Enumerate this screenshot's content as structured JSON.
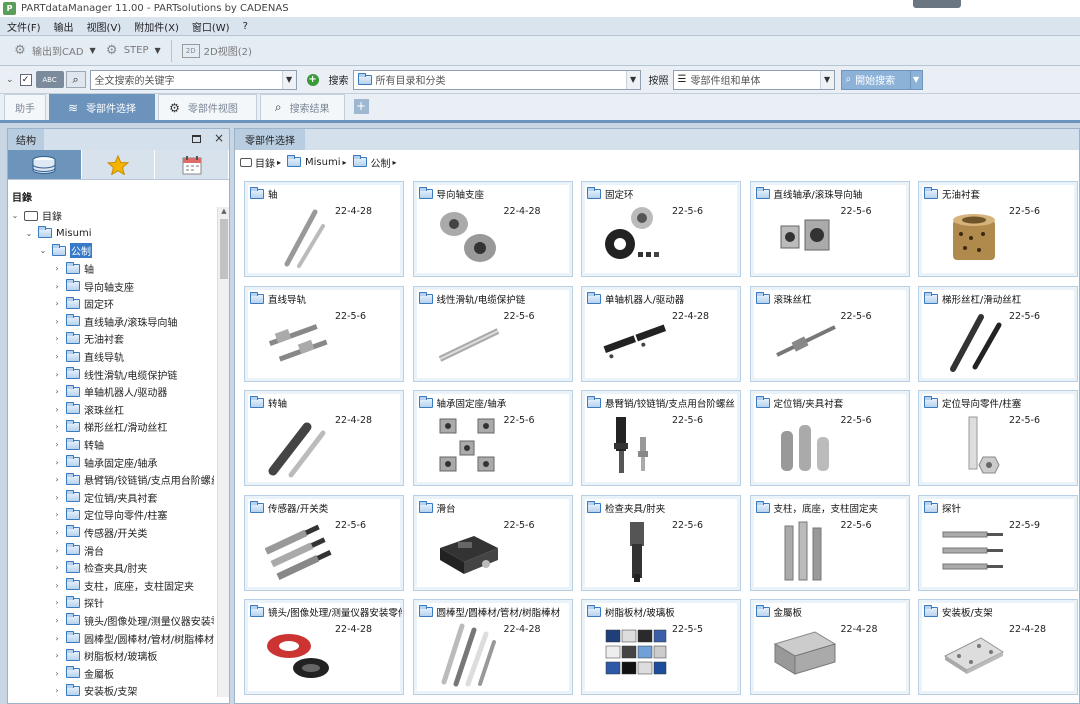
{
  "window": {
    "title": "PARTdataManager 11.00 - PARTsolutions by CADENAS",
    "app_icon": "partsolutions-app-icon"
  },
  "menu": [
    "文件(F)",
    "输出",
    "视图(V)",
    "附加件(X)",
    "窗口(W)",
    "?"
  ],
  "toolbar": {
    "export_cad": "输出到CAD",
    "step": "STEP",
    "view2d": "2D视图(2)"
  },
  "search": {
    "abc": "ABC",
    "fulltext_placeholder": "全文搜索的关键字",
    "search_label": "搜索",
    "catalog_value": "所有目录和分类",
    "by_label": "按照",
    "by_value": "零部件组和单体",
    "start_label": "開始搜索"
  },
  "tabs": [
    {
      "label": "助手",
      "icon": ""
    },
    {
      "label": "零部件选择",
      "icon": "catalog-icon"
    },
    {
      "label": "零部件视图",
      "icon": "parts-view-icon"
    },
    {
      "label": "搜索结果",
      "icon": "magnifier-icon"
    }
  ],
  "left_panel": {
    "title": "结构",
    "root_label": "目錄",
    "tree": [
      {
        "label": "目錄",
        "level": 0,
        "expanded": true,
        "icon": "catalog-icon"
      },
      {
        "label": "Misumi",
        "level": 1,
        "expanded": true,
        "icon": "folder-icon"
      },
      {
        "label": "公制",
        "level": 2,
        "expanded": true,
        "icon": "folder-icon",
        "selected": true
      },
      {
        "label": "轴",
        "level": 3
      },
      {
        "label": "导向轴支座",
        "level": 3
      },
      {
        "label": "固定环",
        "level": 3
      },
      {
        "label": "直线轴承/滚珠导向轴",
        "level": 3
      },
      {
        "label": "无油衬套",
        "level": 3
      },
      {
        "label": "直线导轨",
        "level": 3
      },
      {
        "label": "线性滑轨/电缆保护链",
        "level": 3
      },
      {
        "label": "单轴机器人/驱动器",
        "level": 3
      },
      {
        "label": "滚珠丝杠",
        "level": 3
      },
      {
        "label": "梯形丝杠/滑动丝杠",
        "level": 3
      },
      {
        "label": "转轴",
        "level": 3
      },
      {
        "label": "轴承固定座/轴承",
        "level": 3
      },
      {
        "label": "悬臂销/铰链销/支点用台阶螺丝",
        "level": 3
      },
      {
        "label": "定位销/夹具衬套",
        "level": 3
      },
      {
        "label": "定位导向零件/柱塞",
        "level": 3
      },
      {
        "label": "传感器/开关类",
        "level": 3
      },
      {
        "label": "滑台",
        "level": 3
      },
      {
        "label": "检查夹具/肘夹",
        "level": 3
      },
      {
        "label": "支柱，底座，支柱固定夹",
        "level": 3
      },
      {
        "label": "探针",
        "level": 3
      },
      {
        "label": "镜头/图像处理/测量仪器安装零件",
        "level": 3
      },
      {
        "label": "圆棒型/圆棒材/管材/树脂棒材",
        "level": 3
      },
      {
        "label": "树脂板材/玻璃板",
        "level": 3
      },
      {
        "label": "金屬板",
        "level": 3
      },
      {
        "label": "安装板/支架",
        "level": 3
      }
    ]
  },
  "right_panel": {
    "title": "零部件选择",
    "breadcrumb": [
      "目錄",
      "Misumi",
      "公制"
    ],
    "cards": [
      {
        "label": "轴",
        "date": "22-4-28",
        "img": "shaft"
      },
      {
        "label": "导向轴支座",
        "date": "22-4-28",
        "img": "holder"
      },
      {
        "label": "固定环",
        "date": "22-5-6",
        "img": "collar"
      },
      {
        "label": "直线轴承/滚珠导向轴",
        "date": "22-5-6",
        "img": "linear-bearing"
      },
      {
        "label": "无油衬套",
        "date": "22-5-6",
        "img": "bushing"
      },
      {
        "label": "直线导轨",
        "date": "22-5-6",
        "img": "guide-rail"
      },
      {
        "label": "线性滑轨/电缆保护链",
        "date": "22-5-6",
        "img": "slide-rail"
      },
      {
        "label": "单轴机器人/驱动器",
        "date": "22-4-28",
        "img": "actuator"
      },
      {
        "label": "滚珠丝杠",
        "date": "22-5-6",
        "img": "ball-screw"
      },
      {
        "label": "梯形丝杠/滑动丝杠",
        "date": "22-5-6",
        "img": "lead-screw"
      },
      {
        "label": "转轴",
        "date": "22-4-28",
        "img": "rotary-shaft"
      },
      {
        "label": "轴承固定座/轴承",
        "date": "22-5-6",
        "img": "bearing-housing"
      },
      {
        "label": "悬臂销/铰链销/支点用台阶螺丝",
        "date": "22-5-6",
        "img": "pin"
      },
      {
        "label": "定位销/夹具衬套",
        "date": "22-5-6",
        "img": "locating-pin"
      },
      {
        "label": "定位导向零件/柱塞",
        "date": "22-5-6",
        "img": "plunger"
      },
      {
        "label": "传感器/开关类",
        "date": "22-5-6",
        "img": "sensor"
      },
      {
        "label": "滑台",
        "date": "22-5-6",
        "img": "stage"
      },
      {
        "label": "检查夹具/肘夹",
        "date": "22-5-6",
        "img": "check-fixture"
      },
      {
        "label": "支柱，底座，支柱固定夹",
        "date": "22-5-6",
        "img": "post"
      },
      {
        "label": "探针",
        "date": "22-5-9",
        "img": "probe"
      },
      {
        "label": "镜头/图像处理/测量仪器安装零件",
        "date": "22-4-28",
        "img": "ring-light"
      },
      {
        "label": "圆棒型/圆棒材/管材/树脂棒材",
        "date": "22-4-28",
        "img": "rods"
      },
      {
        "label": "树脂板材/玻璃板",
        "date": "22-5-5",
        "img": "resin-plate"
      },
      {
        "label": "金屬板",
        "date": "22-4-28",
        "img": "metal-plate"
      },
      {
        "label": "安装板/支架",
        "date": "22-4-28",
        "img": "mount-plate"
      }
    ]
  },
  "colors": {
    "accent": "#6b93bb",
    "tree_selected": "#3779c8",
    "folder": "#3a7abf"
  }
}
